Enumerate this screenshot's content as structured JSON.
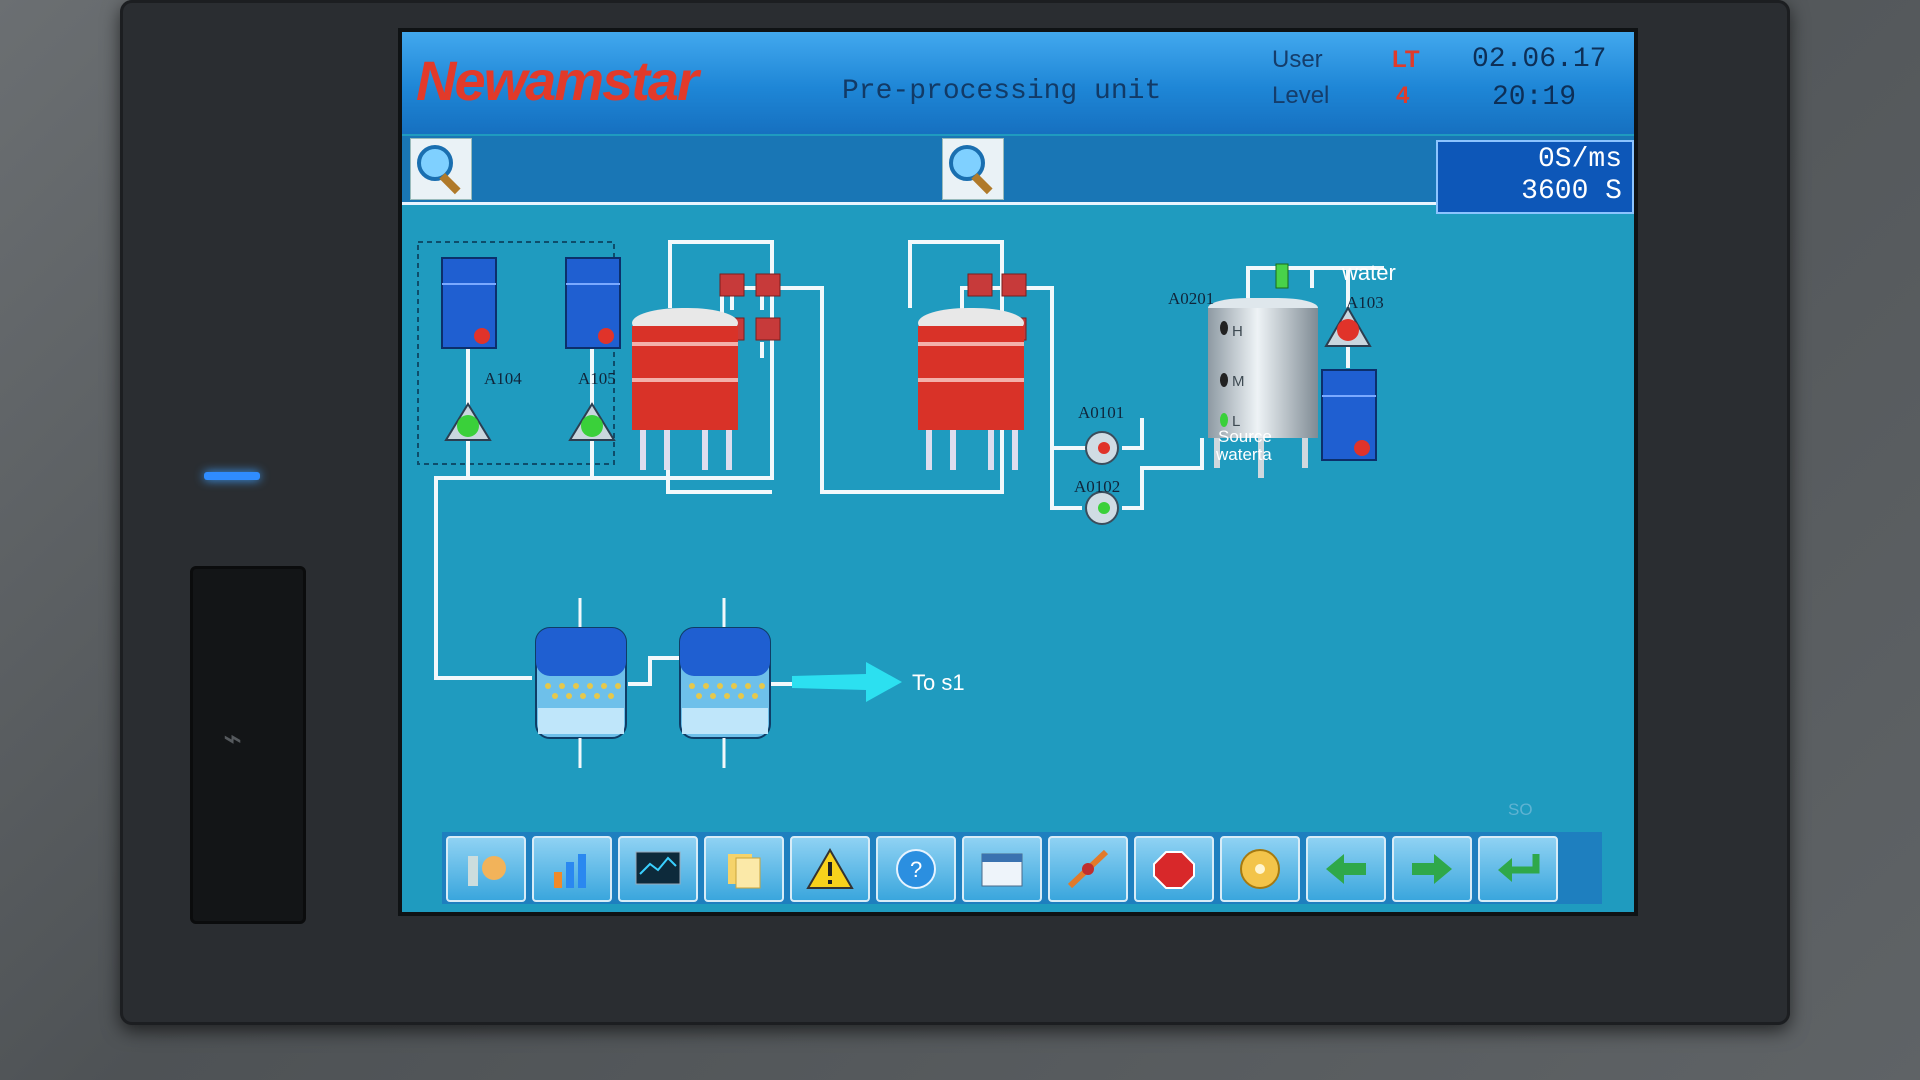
{
  "header": {
    "logo": "Newamstar",
    "title": "Pre-processing unit",
    "user_label": "User",
    "user_value": "LT",
    "level_label": "Level",
    "level_value": "4",
    "date": "02.06.17",
    "time": "20:19"
  },
  "rate": {
    "line1": "0S/ms",
    "line2": "3600 S"
  },
  "diagram": {
    "tags": {
      "a104": "A104",
      "a105": "A105",
      "a0101": "A0101",
      "a0102": "A0102",
      "a0201": "A0201",
      "a103": "A103"
    },
    "water_label": "water",
    "source_label_1": "Source",
    "source_label_2": "waterta",
    "level_h": "H",
    "level_m": "M",
    "level_l": "L",
    "outlet_label": "To s1"
  },
  "footer_mark": "SO",
  "colors": {
    "screen_bg": "#1f9bbf",
    "header": "#1e86d6",
    "brand": "#e23a2a",
    "pipe": "#ffffff",
    "tank_red": "#d93228",
    "drum_blue": "#1f5fd1"
  },
  "bottom_bar": {
    "buttons": [
      "tools-icon",
      "bar-chart-icon",
      "trend-monitor-icon",
      "documents-icon",
      "warning-icon",
      "help-icon",
      "calendar-icon",
      "connect-icon",
      "stop-icon",
      "disc-icon",
      "arrow-left-icon",
      "arrow-right-icon",
      "return-icon"
    ]
  }
}
